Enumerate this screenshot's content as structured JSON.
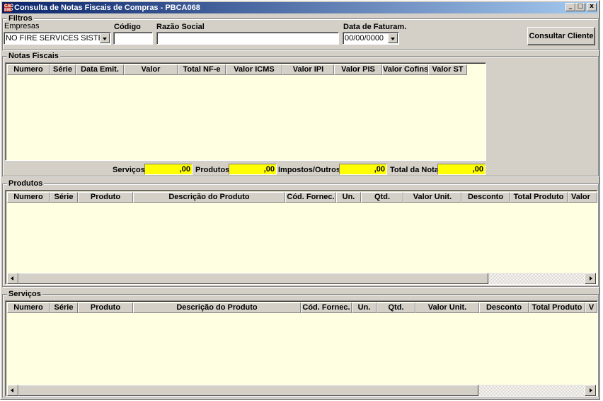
{
  "window": {
    "title": "Consulta de Notas Fiscais de Compras - PBCA068",
    "icon_text": "CAD ERP",
    "controls": {
      "minimize": "_",
      "maximize": "□",
      "close": "x"
    }
  },
  "filtros": {
    "group_label": "Filtros",
    "empresas_label": "Empresas",
    "empresas_value": "NO FIRE SERVICES SISTE",
    "codigo_label": "Código",
    "codigo_value": "",
    "razao_label": "Razão Social",
    "razao_value": "",
    "data_label": "Data de Faturam.",
    "data_value": "00/00/0000",
    "consultar_button": "Consultar Cliente"
  },
  "notas": {
    "group_label": "Notas Fiscais",
    "columns": [
      "Numero",
      "Série",
      "Data Emit.",
      "Valor",
      "Total NF-e",
      "Valor ICMS",
      "Valor IPI",
      "Valor PIS",
      "Valor Cofins",
      "Valor ST"
    ],
    "totals": {
      "servicos_label": "Serviços",
      "servicos_value": ",00",
      "produtos_label": "Produtos",
      "produtos_value": ",00",
      "impostos_label": "Impostos/Outros",
      "impostos_value": ",00",
      "total_label": "Total da Nota",
      "total_value": ",00"
    }
  },
  "produtos": {
    "group_label": "Produtos",
    "columns": [
      "Numero",
      "Série",
      "Produto",
      "Descrição do Produto",
      "Cód. Fornec.",
      "Un.",
      "Qtd.",
      "Valor Unit.",
      "Desconto",
      "Total Produto",
      "Valor"
    ]
  },
  "servicos": {
    "group_label": "Serviços",
    "columns": [
      "Numero",
      "Série",
      "Produto",
      "Descrição do Produto",
      "Cód. Fornec.",
      "Un.",
      "Qtd.",
      "Valor Unit.",
      "Desconto",
      "Total Produto",
      "V"
    ]
  }
}
